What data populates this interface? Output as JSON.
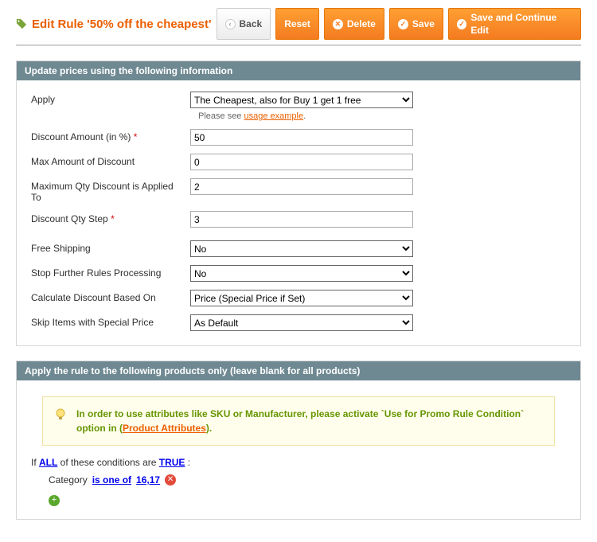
{
  "header": {
    "title": "Edit Rule '50% off the cheapest'",
    "buttons": {
      "back": "Back",
      "reset": "Reset",
      "delete": "Delete",
      "save": "Save",
      "save_continue": "Save and Continue Edit"
    }
  },
  "panel1": {
    "title": "Update prices using the following information",
    "fields": {
      "apply": {
        "label": "Apply",
        "value": "The Cheapest, also for Buy 1 get 1 free",
        "hint_pre": "Please see ",
        "hint_link": "usage example",
        "hint_post": "."
      },
      "discount_amount": {
        "label": "Discount Amount (in %)",
        "value": "50",
        "required": true
      },
      "max_amount": {
        "label": "Max Amount of Discount",
        "value": "0"
      },
      "max_qty": {
        "label": "Maximum Qty Discount is Applied To",
        "value": "2"
      },
      "qty_step": {
        "label": "Discount Qty Step",
        "value": "3",
        "required": true
      },
      "free_shipping": {
        "label": "Free Shipping",
        "value": "No"
      },
      "stop_rules": {
        "label": "Stop Further Rules Processing",
        "value": "No"
      },
      "calc_based": {
        "label": "Calculate Discount Based On",
        "value": "Price (Special Price if Set)"
      },
      "skip_special": {
        "label": "Skip Items with Special Price",
        "value": "As Default"
      }
    }
  },
  "panel2": {
    "title": "Apply the rule to the following products only (leave blank for all products)",
    "note_pre": "In order to use attributes like SKU or Manufacturer, please activate `Use for Promo Rule Condition` option in (",
    "note_link": "Product Attributes",
    "note_post": ").",
    "cond": {
      "if_pre": "If ",
      "all": "ALL",
      "mid": "  of these conditions are ",
      "true": "TRUE",
      "end": " :",
      "attr": "Category",
      "op": "is one of",
      "val": "16,17"
    }
  }
}
